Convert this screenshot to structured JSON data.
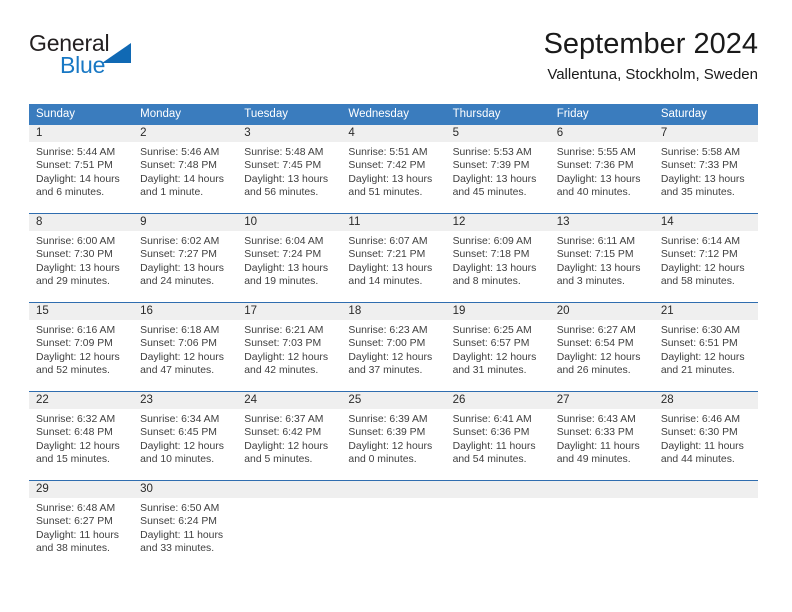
{
  "brand": {
    "name_top": "General",
    "name_bottom": "Blue",
    "color_dark": "#231f20",
    "color_blue": "#1878c4",
    "triangle_icon": "triangle-icon"
  },
  "header": {
    "title": "September 2024",
    "subtitle": "Vallentuna, Stockholm, Sweden"
  },
  "theme": {
    "header_blue": "#3a7cbe",
    "separator_blue": "#2f6daf",
    "daynum_band": "#efefef",
    "text": "#404040"
  },
  "weekdays": [
    "Sunday",
    "Monday",
    "Tuesday",
    "Wednesday",
    "Thursday",
    "Friday",
    "Saturday"
  ],
  "weeks": [
    [
      {
        "day": "1",
        "sunrise": "Sunrise: 5:44 AM",
        "sunset": "Sunset: 7:51 PM",
        "daylight_line1": "Daylight: 14 hours",
        "daylight_line2": "and 6 minutes."
      },
      {
        "day": "2",
        "sunrise": "Sunrise: 5:46 AM",
        "sunset": "Sunset: 7:48 PM",
        "daylight_line1": "Daylight: 14 hours",
        "daylight_line2": "and 1 minute."
      },
      {
        "day": "3",
        "sunrise": "Sunrise: 5:48 AM",
        "sunset": "Sunset: 7:45 PM",
        "daylight_line1": "Daylight: 13 hours",
        "daylight_line2": "and 56 minutes."
      },
      {
        "day": "4",
        "sunrise": "Sunrise: 5:51 AM",
        "sunset": "Sunset: 7:42 PM",
        "daylight_line1": "Daylight: 13 hours",
        "daylight_line2": "and 51 minutes."
      },
      {
        "day": "5",
        "sunrise": "Sunrise: 5:53 AM",
        "sunset": "Sunset: 7:39 PM",
        "daylight_line1": "Daylight: 13 hours",
        "daylight_line2": "and 45 minutes."
      },
      {
        "day": "6",
        "sunrise": "Sunrise: 5:55 AM",
        "sunset": "Sunset: 7:36 PM",
        "daylight_line1": "Daylight: 13 hours",
        "daylight_line2": "and 40 minutes."
      },
      {
        "day": "7",
        "sunrise": "Sunrise: 5:58 AM",
        "sunset": "Sunset: 7:33 PM",
        "daylight_line1": "Daylight: 13 hours",
        "daylight_line2": "and 35 minutes."
      }
    ],
    [
      {
        "day": "8",
        "sunrise": "Sunrise: 6:00 AM",
        "sunset": "Sunset: 7:30 PM",
        "daylight_line1": "Daylight: 13 hours",
        "daylight_line2": "and 29 minutes."
      },
      {
        "day": "9",
        "sunrise": "Sunrise: 6:02 AM",
        "sunset": "Sunset: 7:27 PM",
        "daylight_line1": "Daylight: 13 hours",
        "daylight_line2": "and 24 minutes."
      },
      {
        "day": "10",
        "sunrise": "Sunrise: 6:04 AM",
        "sunset": "Sunset: 7:24 PM",
        "daylight_line1": "Daylight: 13 hours",
        "daylight_line2": "and 19 minutes."
      },
      {
        "day": "11",
        "sunrise": "Sunrise: 6:07 AM",
        "sunset": "Sunset: 7:21 PM",
        "daylight_line1": "Daylight: 13 hours",
        "daylight_line2": "and 14 minutes."
      },
      {
        "day": "12",
        "sunrise": "Sunrise: 6:09 AM",
        "sunset": "Sunset: 7:18 PM",
        "daylight_line1": "Daylight: 13 hours",
        "daylight_line2": "and 8 minutes."
      },
      {
        "day": "13",
        "sunrise": "Sunrise: 6:11 AM",
        "sunset": "Sunset: 7:15 PM",
        "daylight_line1": "Daylight: 13 hours",
        "daylight_line2": "and 3 minutes."
      },
      {
        "day": "14",
        "sunrise": "Sunrise: 6:14 AM",
        "sunset": "Sunset: 7:12 PM",
        "daylight_line1": "Daylight: 12 hours",
        "daylight_line2": "and 58 minutes."
      }
    ],
    [
      {
        "day": "15",
        "sunrise": "Sunrise: 6:16 AM",
        "sunset": "Sunset: 7:09 PM",
        "daylight_line1": "Daylight: 12 hours",
        "daylight_line2": "and 52 minutes."
      },
      {
        "day": "16",
        "sunrise": "Sunrise: 6:18 AM",
        "sunset": "Sunset: 7:06 PM",
        "daylight_line1": "Daylight: 12 hours",
        "daylight_line2": "and 47 minutes."
      },
      {
        "day": "17",
        "sunrise": "Sunrise: 6:21 AM",
        "sunset": "Sunset: 7:03 PM",
        "daylight_line1": "Daylight: 12 hours",
        "daylight_line2": "and 42 minutes."
      },
      {
        "day": "18",
        "sunrise": "Sunrise: 6:23 AM",
        "sunset": "Sunset: 7:00 PM",
        "daylight_line1": "Daylight: 12 hours",
        "daylight_line2": "and 37 minutes."
      },
      {
        "day": "19",
        "sunrise": "Sunrise: 6:25 AM",
        "sunset": "Sunset: 6:57 PM",
        "daylight_line1": "Daylight: 12 hours",
        "daylight_line2": "and 31 minutes."
      },
      {
        "day": "20",
        "sunrise": "Sunrise: 6:27 AM",
        "sunset": "Sunset: 6:54 PM",
        "daylight_line1": "Daylight: 12 hours",
        "daylight_line2": "and 26 minutes."
      },
      {
        "day": "21",
        "sunrise": "Sunrise: 6:30 AM",
        "sunset": "Sunset: 6:51 PM",
        "daylight_line1": "Daylight: 12 hours",
        "daylight_line2": "and 21 minutes."
      }
    ],
    [
      {
        "day": "22",
        "sunrise": "Sunrise: 6:32 AM",
        "sunset": "Sunset: 6:48 PM",
        "daylight_line1": "Daylight: 12 hours",
        "daylight_line2": "and 15 minutes."
      },
      {
        "day": "23",
        "sunrise": "Sunrise: 6:34 AM",
        "sunset": "Sunset: 6:45 PM",
        "daylight_line1": "Daylight: 12 hours",
        "daylight_line2": "and 10 minutes."
      },
      {
        "day": "24",
        "sunrise": "Sunrise: 6:37 AM",
        "sunset": "Sunset: 6:42 PM",
        "daylight_line1": "Daylight: 12 hours",
        "daylight_line2": "and 5 minutes."
      },
      {
        "day": "25",
        "sunrise": "Sunrise: 6:39 AM",
        "sunset": "Sunset: 6:39 PM",
        "daylight_line1": "Daylight: 12 hours",
        "daylight_line2": "and 0 minutes."
      },
      {
        "day": "26",
        "sunrise": "Sunrise: 6:41 AM",
        "sunset": "Sunset: 6:36 PM",
        "daylight_line1": "Daylight: 11 hours",
        "daylight_line2": "and 54 minutes."
      },
      {
        "day": "27",
        "sunrise": "Sunrise: 6:43 AM",
        "sunset": "Sunset: 6:33 PM",
        "daylight_line1": "Daylight: 11 hours",
        "daylight_line2": "and 49 minutes."
      },
      {
        "day": "28",
        "sunrise": "Sunrise: 6:46 AM",
        "sunset": "Sunset: 6:30 PM",
        "daylight_line1": "Daylight: 11 hours",
        "daylight_line2": "and 44 minutes."
      }
    ],
    [
      {
        "day": "29",
        "sunrise": "Sunrise: 6:48 AM",
        "sunset": "Sunset: 6:27 PM",
        "daylight_line1": "Daylight: 11 hours",
        "daylight_line2": "and 38 minutes."
      },
      {
        "day": "30",
        "sunrise": "Sunrise: 6:50 AM",
        "sunset": "Sunset: 6:24 PM",
        "daylight_line1": "Daylight: 11 hours",
        "daylight_line2": "and 33 minutes."
      },
      {
        "day": "",
        "sunrise": "",
        "sunset": "",
        "daylight_line1": "",
        "daylight_line2": ""
      },
      {
        "day": "",
        "sunrise": "",
        "sunset": "",
        "daylight_line1": "",
        "daylight_line2": ""
      },
      {
        "day": "",
        "sunrise": "",
        "sunset": "",
        "daylight_line1": "",
        "daylight_line2": ""
      },
      {
        "day": "",
        "sunrise": "",
        "sunset": "",
        "daylight_line1": "",
        "daylight_line2": ""
      },
      {
        "day": "",
        "sunrise": "",
        "sunset": "",
        "daylight_line1": "",
        "daylight_line2": ""
      }
    ]
  ]
}
